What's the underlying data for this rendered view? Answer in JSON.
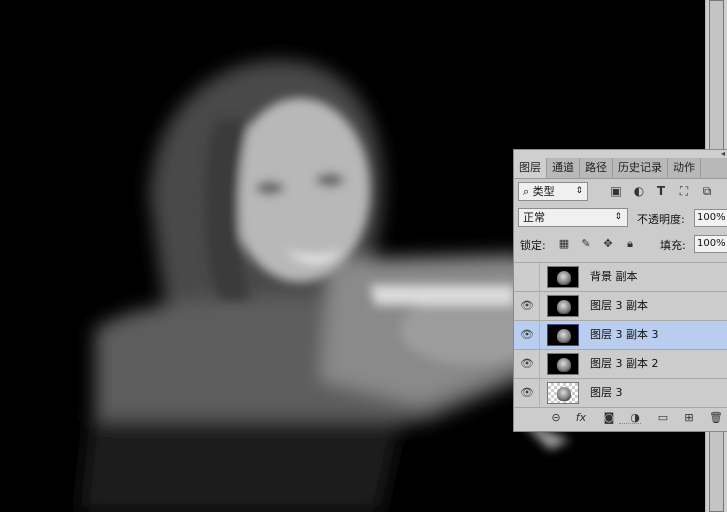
{
  "tabs": [
    "图层",
    "通道",
    "路径",
    "历史记录",
    "动作"
  ],
  "filter": {
    "label": "类型",
    "icons": [
      "image-filter-icon",
      "adjustment-filter-icon",
      "type-filter-icon",
      "shape-filter-icon",
      "smart-object-filter-icon"
    ],
    "glyph_T": "T"
  },
  "blend": {
    "mode": "正常",
    "opacity_label": "不透明度:",
    "opacity_value": "100%"
  },
  "lock": {
    "label": "锁定:",
    "fill_label": "填充:",
    "fill_value": "100%"
  },
  "layers": [
    {
      "name": "背景 副本",
      "visible": false,
      "selected": false
    },
    {
      "name": "图层 3 副本",
      "visible": true,
      "selected": false
    },
    {
      "name": "图层 3 副本 3",
      "visible": true,
      "selected": true
    },
    {
      "name": "图层 3 副本 2",
      "visible": true,
      "selected": false
    },
    {
      "name": "图层 3",
      "visible": true,
      "selected": false
    }
  ],
  "bottom_icons": [
    "link-icon",
    "fx-icon",
    "mask-icon",
    "adjustment-layer-icon",
    "group-folder-icon",
    "new-layer-icon",
    "trash-icon"
  ],
  "fx_label": "fx",
  "colors": {
    "panel_bg": "#cccccc",
    "selected_row": "#b9cdee",
    "canvas_bg": "#000000"
  }
}
